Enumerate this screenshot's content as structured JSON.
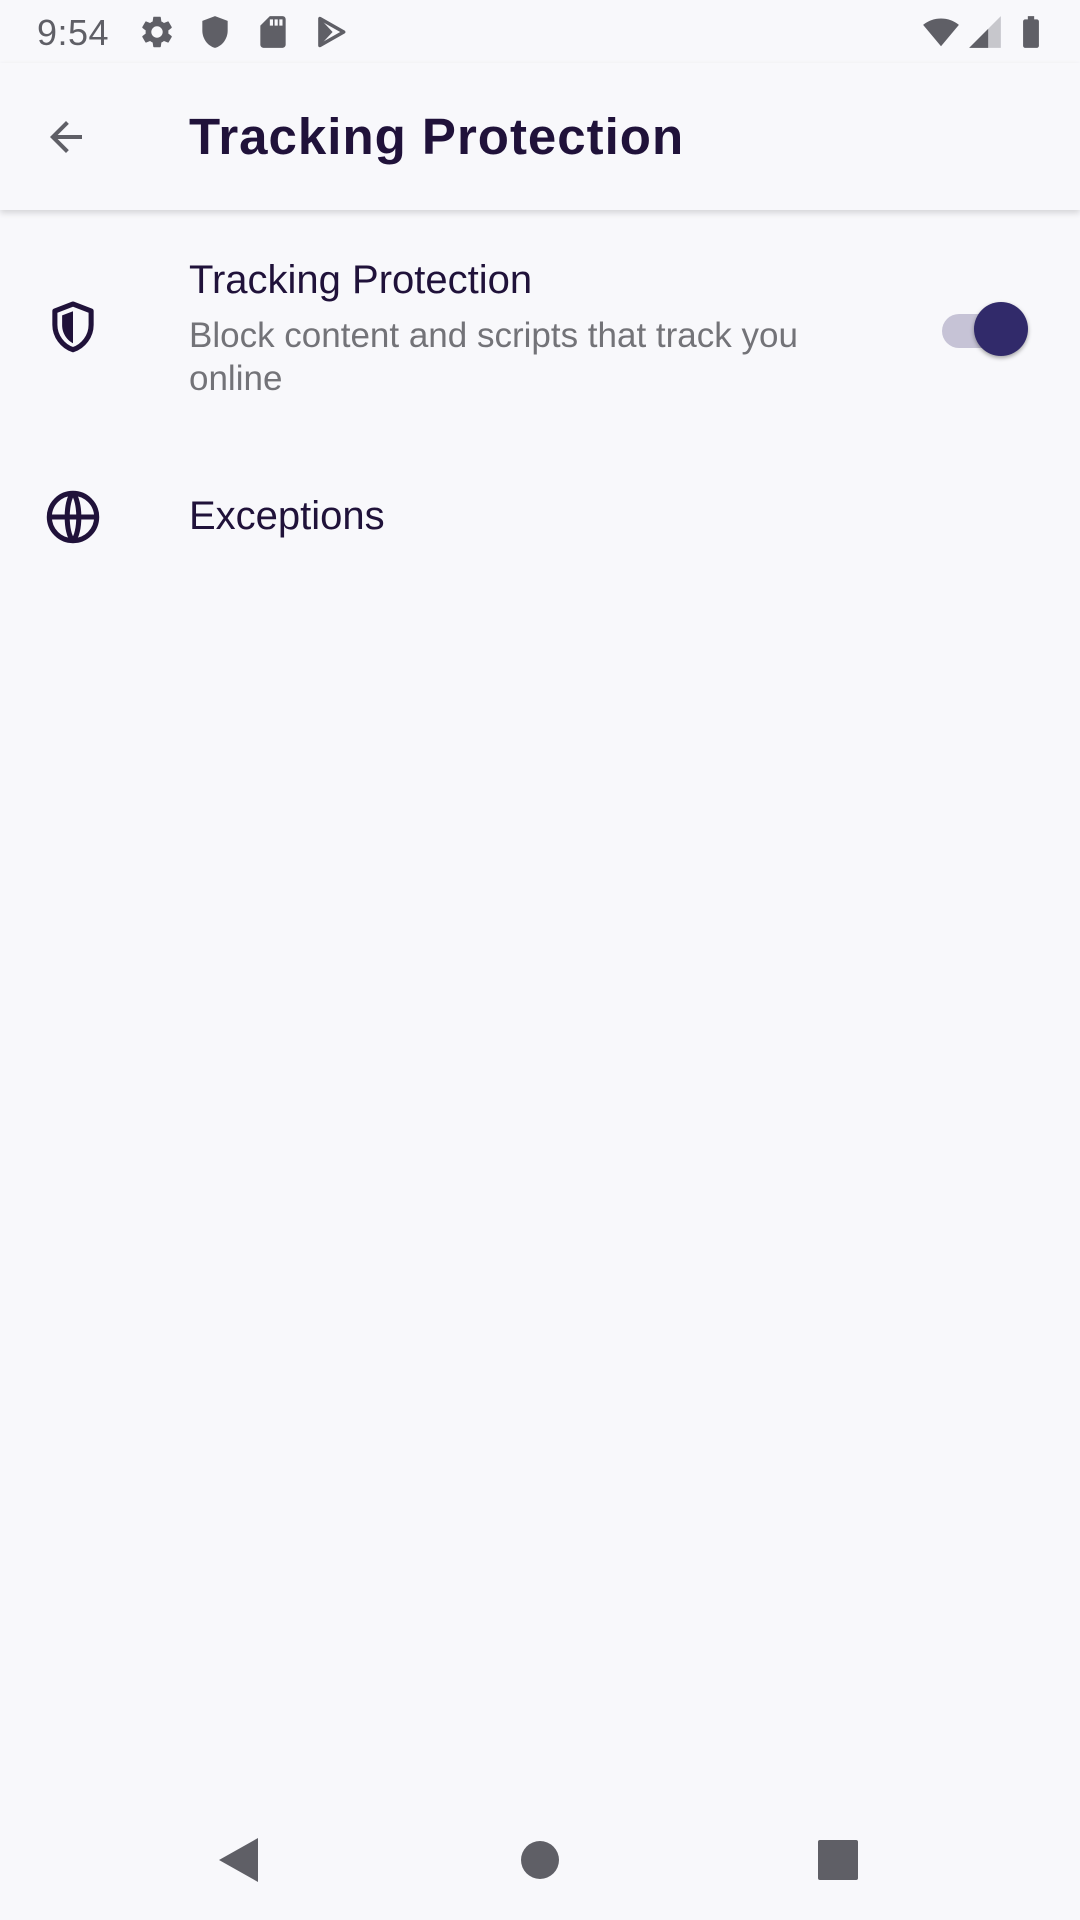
{
  "status_bar": {
    "time": "9:54",
    "left_icons": [
      "settings-gear-icon",
      "shield-icon",
      "sd-card-icon",
      "play-store-icon"
    ],
    "right_icons": [
      "wifi-icon",
      "cell-signal-icon",
      "battery-icon"
    ]
  },
  "app_bar": {
    "title": "Tracking Protection",
    "back_icon": "arrow-back-icon"
  },
  "settings": {
    "tracking": {
      "icon": "shield-icon",
      "title": "Tracking Protection",
      "summary": "Block content and scripts that track you online",
      "enabled": true
    },
    "exceptions": {
      "icon": "globe-icon",
      "title": "Exceptions"
    }
  },
  "nav_bar": {
    "buttons": [
      "back-triangle-icon",
      "home-circle-icon",
      "recents-square-icon"
    ]
  },
  "colors": {
    "background": "#f8f8fb",
    "primary_text": "#20123a",
    "secondary_text": "#737378",
    "switch_thumb": "#312a6a",
    "switch_track": "#c6c3d6",
    "system_icon": "#5f5f66"
  }
}
